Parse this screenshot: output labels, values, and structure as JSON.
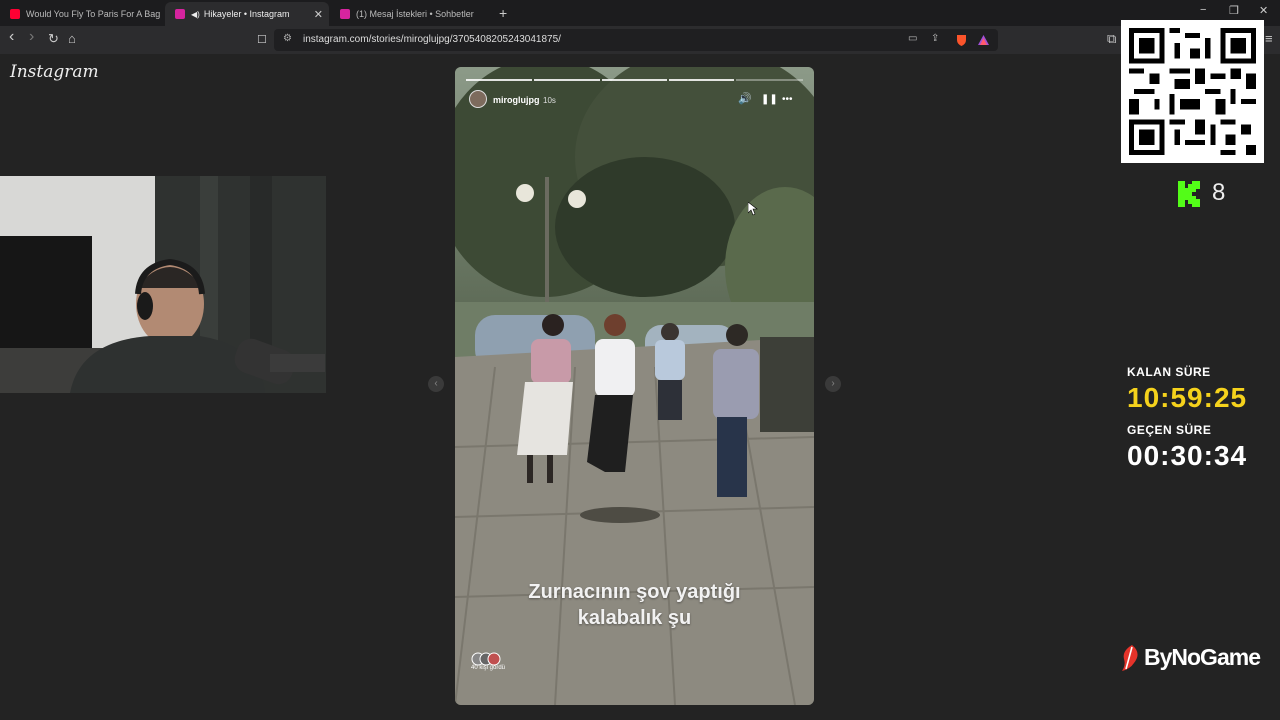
{
  "browser": {
    "tabs": [
      {
        "label": "Would You Fly To Paris For A Baguett",
        "favicon_color": "#ff0033",
        "active": false
      },
      {
        "label": "Hikayeler • Instagram",
        "favicon_color": "#d6249f",
        "active": true
      },
      {
        "label": "(1) Mesaj İstekleri • Sohbetler",
        "favicon_color": "#d6249f",
        "active": false
      }
    ],
    "new_tab": "+",
    "window_controls": {
      "minimize": "−",
      "restore": "❐",
      "close": "✕"
    },
    "nav": {
      "back": "‹",
      "forward": "›",
      "reload": "↻",
      "home": "⌂"
    },
    "url": "instagram.com/stories/miroglujpg/3705408205243041875/",
    "bookmark_icon": "☐",
    "site_info_icon": "⚙"
  },
  "instagram": {
    "logo": "Instagram"
  },
  "story": {
    "username": "miroglujpg",
    "time": "10s",
    "caption_line1": "Zurnacının şov yaptığı",
    "caption_line2": "kalabalık şu",
    "viewers": "40 kişi gördü",
    "segments_total": 5,
    "segments_completed": 4,
    "icons": {
      "sound": "🔊",
      "pause": "❚❚",
      "more": "•••"
    }
  },
  "overlay": {
    "kick_count": "8",
    "remaining_label": "KALAN SÜRE",
    "remaining_value": "10:59:25",
    "elapsed_label": "GEÇEN SÜRE",
    "elapsed_value": "00:30:34",
    "sponsor": "ByNoGame",
    "colors": {
      "remaining": "#f5d21c",
      "elapsed": "#ffffff",
      "kick": "#53fc18"
    }
  }
}
